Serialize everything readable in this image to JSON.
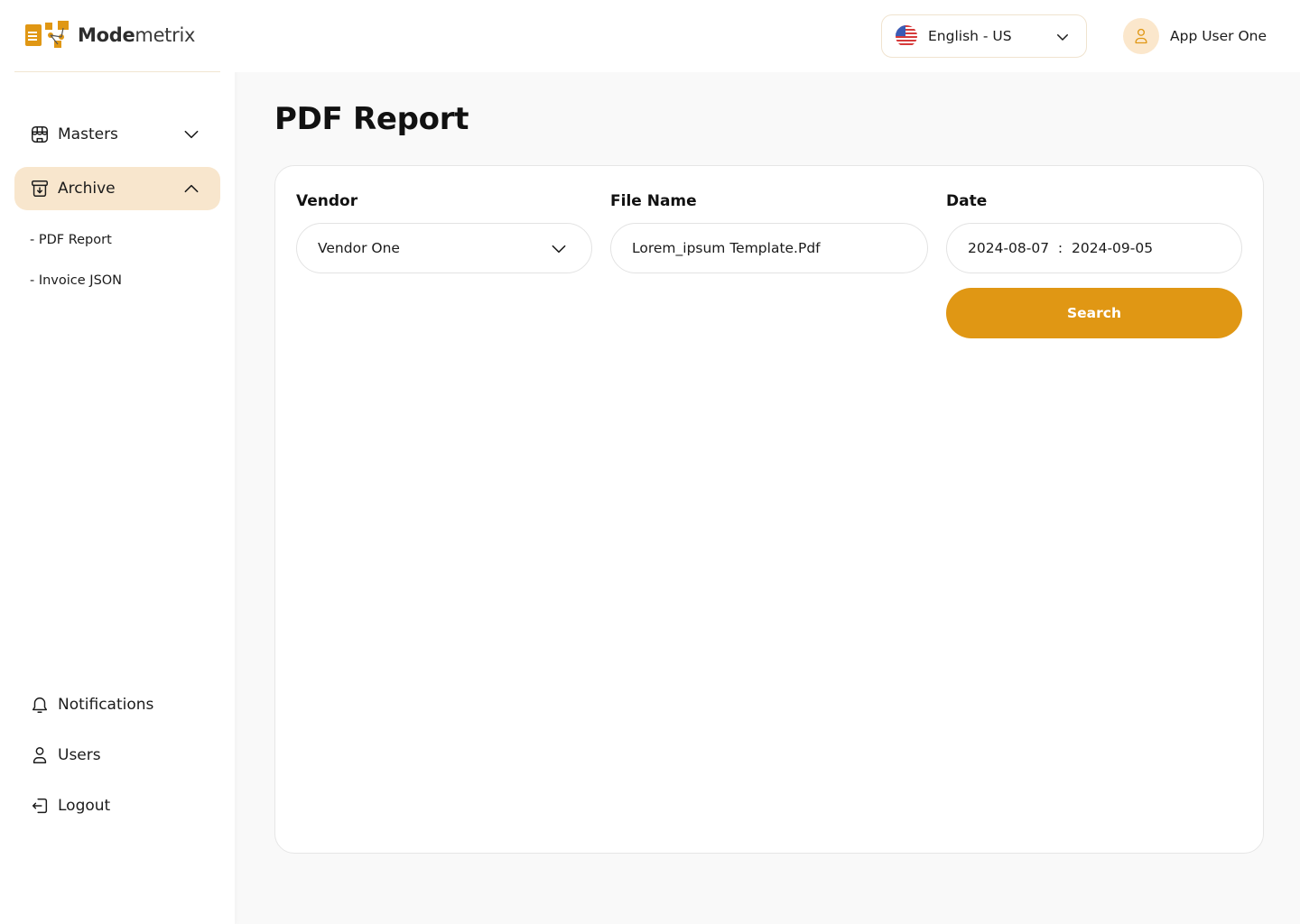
{
  "brand": {
    "name_bold": "Mode",
    "name_rest": "metrix",
    "accent_color": "#e09714"
  },
  "sidebar": {
    "items": [
      {
        "label": "Masters",
        "icon": "storefront-icon",
        "state": "collapsed"
      },
      {
        "label": "Archive",
        "icon": "archive-box-icon",
        "state": "expanded",
        "active": true
      }
    ],
    "sub_items": [
      {
        "label": "- PDF Report"
      },
      {
        "label": "- Invoice JSON"
      }
    ],
    "bottom_items": [
      {
        "label": "Notifications",
        "icon": "bell-icon"
      },
      {
        "label": "Users",
        "icon": "user-icon"
      },
      {
        "label": "Logout",
        "icon": "logout-icon"
      }
    ]
  },
  "header": {
    "language": {
      "label": "English - US",
      "icon": "us-flag-icon"
    },
    "user": {
      "name": "App User One",
      "icon": "user-icon"
    }
  },
  "main": {
    "title": "PDF Report",
    "filters": {
      "vendor": {
        "label": "Vendor",
        "value": "Vendor One"
      },
      "file_name": {
        "label": "File Name",
        "value": "Lorem_ipsum Template.Pdf"
      },
      "date": {
        "label": "Date",
        "value": "2024-08-07  :  2024-09-05"
      }
    },
    "search_label": "Search"
  }
}
